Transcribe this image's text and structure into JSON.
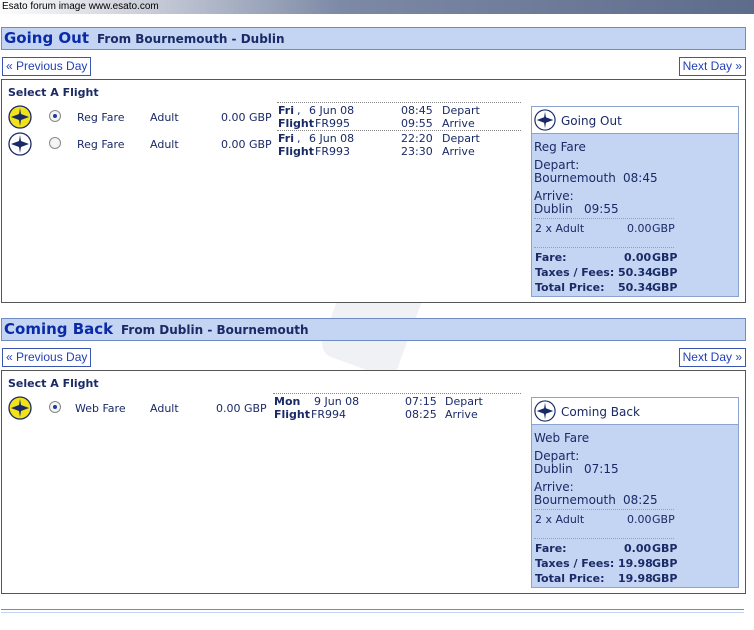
{
  "banner": "Esato forum image www.esato.com",
  "colors": {
    "header_bg": "#c3d5f3",
    "title_text": "#0b2aa8",
    "text": "#1a2a66",
    "plane_selected": "#f2e21a"
  },
  "outbound": {
    "title": "Going Out",
    "route": "From  Bournemouth - Dublin",
    "prev_label": "« Previous Day",
    "next_label": "Next Day »",
    "select_label": "Select A Flight",
    "flights": [
      {
        "fare_type": "Reg Fare",
        "passenger": "Adult",
        "price": "0.00 GBP",
        "day": "Fri",
        "date": "6 Jun 08",
        "flight_label": "Flight",
        "flight_no": "FR995",
        "depart_time": "08:45",
        "arrive_time": "09:55",
        "depart_label": "Depart",
        "arrive_label": "Arrive",
        "selected": true
      },
      {
        "fare_type": "Reg Fare",
        "passenger": "Adult",
        "price": "0.00 GBP",
        "day": "Fri",
        "date": "6 Jun 08",
        "flight_label": "Flight",
        "flight_no": "FR993",
        "depart_time": "22:20",
        "arrive_time": "23:30",
        "depart_label": "Depart",
        "arrive_label": "Arrive",
        "selected": false
      }
    ],
    "summary": {
      "title": "Going Out",
      "fare_type": "Reg Fare",
      "depart_label": "Depart:",
      "depart_place": "Bournemouth",
      "depart_time": "08:45",
      "arrive_label": "Arrive:",
      "arrive_place": "Dublin",
      "arrive_time": "09:55",
      "pax_line": "2  x  Adult",
      "pax_price": "0.00",
      "currency": "GBP",
      "fare_label": "Fare:",
      "fare_value": "0.00",
      "taxes_label": "Taxes / Fees:",
      "taxes_value": "50.34",
      "total_label": "Total Price:",
      "total_value": "50.34"
    }
  },
  "return": {
    "title": "Coming Back",
    "route": "From  Dublin - Bournemouth",
    "prev_label": "« Previous Day",
    "next_label": "Next Day »",
    "select_label": "Select A Flight",
    "flights": [
      {
        "fare_type": "Web Fare",
        "passenger": "Adult",
        "price": "0.00 GBP",
        "day": "Mon",
        "date": "9 Jun 08",
        "flight_label": "Flight",
        "flight_no": "FR994",
        "depart_time": "07:15",
        "arrive_time": "08:25",
        "depart_label": "Depart",
        "arrive_label": "Arrive",
        "selected": true
      }
    ],
    "summary": {
      "title": "Coming Back",
      "fare_type": "Web Fare",
      "depart_label": "Depart:",
      "depart_place": "Dublin",
      "depart_time": "07:15",
      "arrive_label": "Arrive:",
      "arrive_place": "Bournemouth",
      "arrive_time": "08:25",
      "pax_line": "2  x  Adult",
      "pax_price": "0.00",
      "currency": "GBP",
      "fare_label": "Fare:",
      "fare_value": "0.00",
      "taxes_label": "Taxes / Fees:",
      "taxes_value": "19.98",
      "total_label": "Total Price:",
      "total_value": "19.98"
    }
  }
}
